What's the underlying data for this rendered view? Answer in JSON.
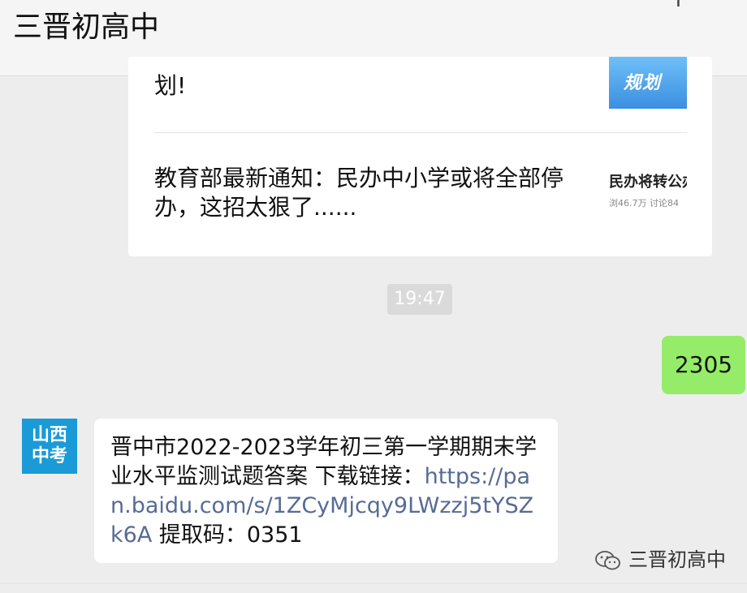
{
  "header": {
    "title": "三晋初高中",
    "plus_icon": "+"
  },
  "article_card": {
    "items": [
      {
        "title": "划!",
        "thumb_text": "规划"
      },
      {
        "title": "教育部最新通知：民办中小学或将全部停办，这招太狠了......",
        "thumb_headline": "民办将转公办",
        "thumb_meta": "浏46.7万  讨论84"
      }
    ]
  },
  "chat": {
    "timestamp": "19:47",
    "outgoing_message": "2305",
    "sender_avatar": {
      "line1": "山西",
      "line2": "中考"
    },
    "incoming_message": {
      "text": "晋中市2022-2023学年初三第一学期期末学业水平监测试题答案 下载链接：",
      "link": "https://pan.baidu.com/s/1ZCyMjcqy9LWzzj5tYSZk6A",
      "suffix": " 提取码：0351"
    }
  },
  "watermark": {
    "icon": "wechat-icon",
    "text": "三晋初高中"
  },
  "colors": {
    "outgoing_bubble": "#95ec69",
    "link": "#576b95",
    "avatar_bg": "#1a9bd7",
    "background": "#ededed"
  }
}
